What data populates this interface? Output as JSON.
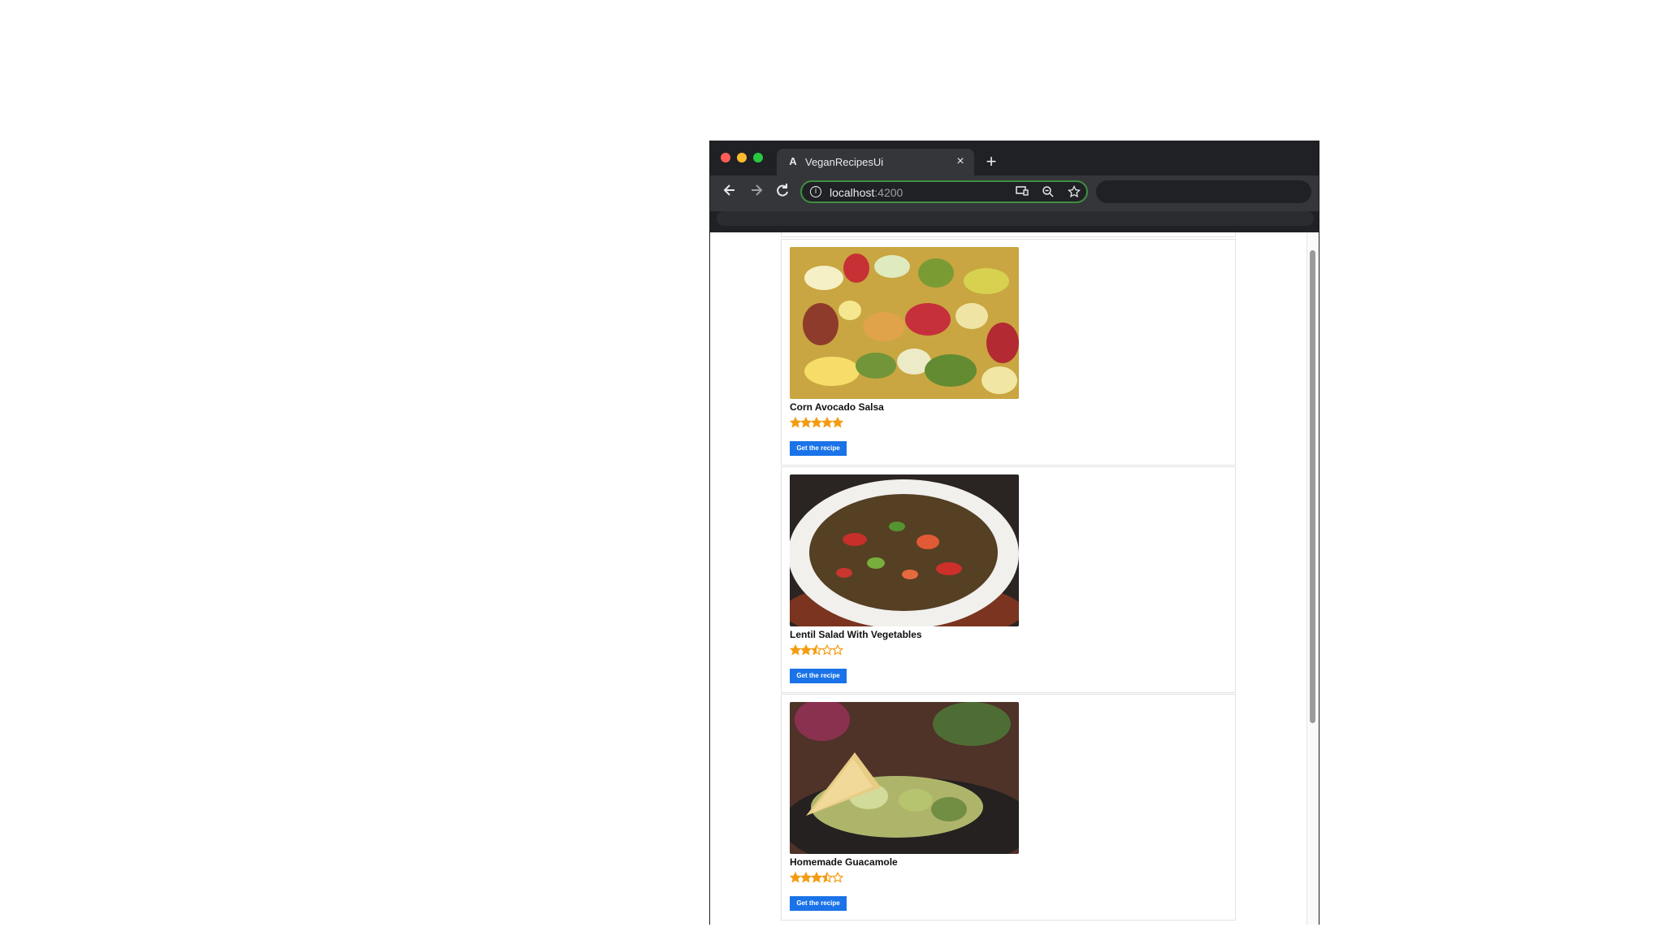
{
  "browser": {
    "tab_title": "VeganRecipesUi",
    "tab_favicon": "A",
    "tab_close": "×",
    "new_tab": "+",
    "url_host": "localhost",
    "url_port": ":4200",
    "address_focus_color": "#3f8f43",
    "icons": [
      "angular-favicon-icon",
      "back-arrow-icon",
      "forward-arrow-icon",
      "reload-icon",
      "info-icon",
      "cast-icon",
      "zoom-icon",
      "bookmark-star-icon"
    ]
  },
  "recipes": [
    {
      "title": "Corn Avocado Salsa",
      "rating": 5,
      "max_rating": 5,
      "button_label": "Get the recipe",
      "image_content": "corn, avocado, red onion and tomato salsa"
    },
    {
      "title": "Lentil Salad With Vegetables",
      "rating": 2.5,
      "max_rating": 5,
      "button_label": "Get the recipe",
      "image_content": "lentil salad with peppers in white bowl"
    },
    {
      "title": "Homemade Guacamole",
      "rating": 3.5,
      "max_rating": 5,
      "button_label": "Get the recipe",
      "image_content": "guacamole with tortilla chip"
    }
  ],
  "colors": {
    "star": "#f39c12",
    "button": "#1a73e8"
  },
  "scrollbar": {
    "position_fraction": 0.08
  }
}
